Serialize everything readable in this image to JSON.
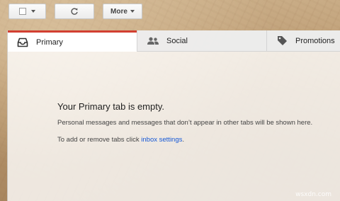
{
  "toolbar": {
    "more_label": "More"
  },
  "tabs": [
    {
      "label": "Primary",
      "icon": "inbox-icon",
      "selected": true
    },
    {
      "label": "Social",
      "icon": "people-icon",
      "selected": false
    },
    {
      "label": "Promotions",
      "icon": "tag-icon",
      "selected": false
    }
  ],
  "empty_state": {
    "title": "Your Primary tab is empty.",
    "description": "Personal messages and messages that don’t appear in other tabs will be shown here.",
    "hint_prefix": "To add or remove tabs click ",
    "hint_link": "inbox settings",
    "hint_suffix": "."
  },
  "watermark": "wsxdn.com",
  "colors": {
    "selected_tab_accent": "#d23f31",
    "link": "#1558d6"
  }
}
